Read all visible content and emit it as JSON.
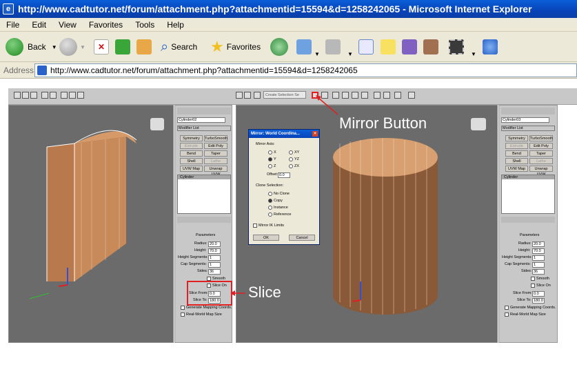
{
  "window": {
    "title": "http://www.cadtutor.net/forum/attachment.php?attachmentid=15594&d=1258242065 - Microsoft Internet Explorer"
  },
  "menu": [
    "File",
    "Edit",
    "View",
    "Favorites",
    "Tools",
    "Help"
  ],
  "toolbar": {
    "back": "Back",
    "search": "Search",
    "favorites": "Favorites"
  },
  "address": {
    "label": "Address",
    "url": "http://www.cadtutor.net/forum/attachment.php?attachmentid=15594&d=1258242065"
  },
  "max": {
    "selection_set": "Create Selection Se",
    "left_panel": {
      "object_name": "Cylinder02",
      "modifier_list": "Modifier List",
      "buttons": [
        "Symmetry",
        "TurboSmooth",
        "Extrude",
        "Edit Poly",
        "Bend",
        "Taper",
        "Shell",
        "Lathe",
        "UVW Map",
        "Unwrap UVW"
      ],
      "stack_item": "Cylinder",
      "parameters_title": "Parameters",
      "radius_label": "Radius:",
      "radius": "20.0",
      "height_label": "Height:",
      "height": "70.0",
      "height_segs_label": "Height Segments:",
      "height_segs": "1",
      "cap_segs_label": "Cap Segments:",
      "cap_segs": "1",
      "sides_label": "Sides:",
      "sides": "36",
      "smooth": "Smooth",
      "slice_on": "Slice On",
      "slice_from_label": "Slice From:",
      "slice_from": "0.0",
      "slice_to_label": "Slice To:",
      "slice_to": "180.0",
      "gen_mapping": "Generate Mapping Coords.",
      "real_world": "Real-World Map Size"
    },
    "right_panel": {
      "object_name": "Cylinder03",
      "modifier_list": "Modifier List",
      "buttons": [
        "Symmetry",
        "TurboSmooth",
        "Extrude",
        "Edit Poly",
        "Bend",
        "Taper",
        "Shell",
        "Lathe",
        "UVW Map",
        "Unwrap UVW"
      ],
      "stack_item": "Cylinder",
      "parameters_title": "Parameters",
      "radius_label": "Radius:",
      "radius": "20.0",
      "height_label": "Height:",
      "height": "70.0",
      "height_segs_label": "Height Segments:",
      "height_segs": "1",
      "cap_segs_label": "Cap Segments:",
      "cap_segs": "1",
      "sides_label": "Sides:",
      "sides": "36",
      "smooth": "Smooth",
      "slice_on": "Slice On",
      "slice_from_label": "Slice From:",
      "slice_from": "0.0",
      "slice_to_label": "Slice To:",
      "slice_to": "180.0",
      "gen_mapping": "Generate Mapping Coords.",
      "real_world": "Real-World Map Size"
    },
    "dialog": {
      "title": "Mirror: World Coordina...",
      "mirror_axis": "Mirror Axis:",
      "axes": [
        "X",
        "Y",
        "Z",
        "XY",
        "YZ",
        "ZX"
      ],
      "offset_label": "Offset:",
      "offset": "0.0",
      "clone_selection": "Clone Selection:",
      "clone_options": [
        "No Clone",
        "Copy",
        "Instance",
        "Reference"
      ],
      "mirror_ik": "Mirror IK Limits",
      "ok": "OK",
      "cancel": "Cancel"
    }
  },
  "annotations": {
    "mirror": "Mirror Button",
    "slice": "Slice"
  },
  "colors": {
    "annotation_red": "#e02020",
    "xp_blue": "#0843b8",
    "cylinder": "#c98a5a"
  }
}
